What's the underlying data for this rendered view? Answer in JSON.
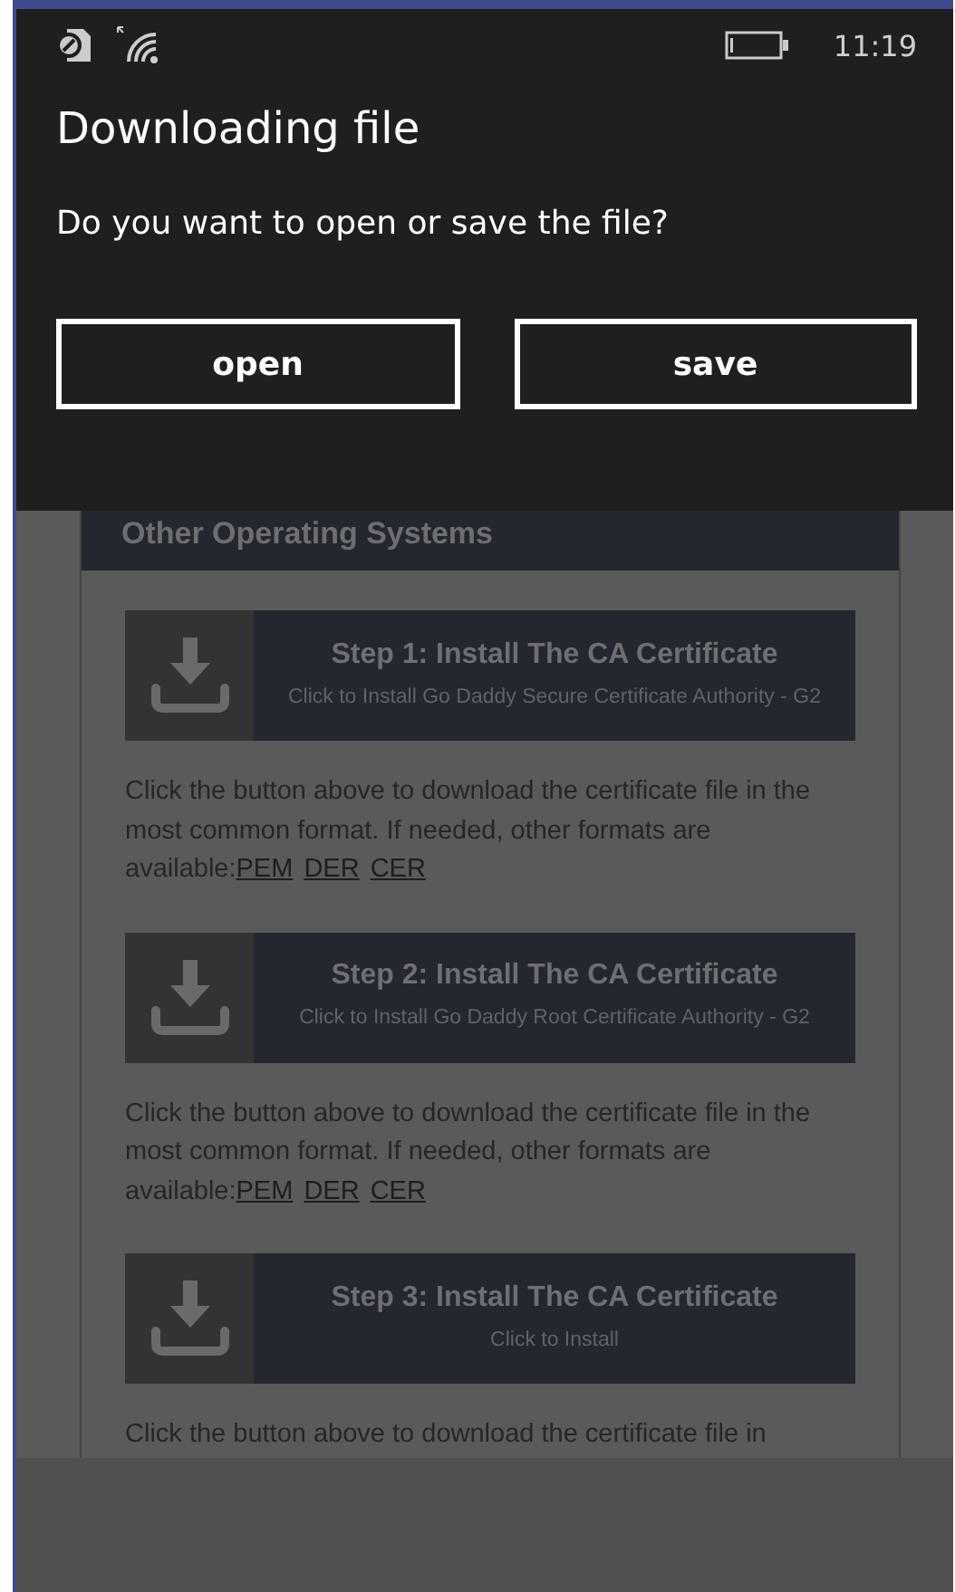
{
  "status_bar": {
    "time": "11:19"
  },
  "dialog": {
    "title": "Downloading file",
    "message": "Do you want to open or save the file?",
    "buttons": [
      "open",
      "save"
    ]
  },
  "page": {
    "section_title": "Other Operating Systems",
    "steps": [
      {
        "title": "Step 1: Install The CA Certificate",
        "subtitle": "Click to Install Go Daddy Secure Certificate Authority - G2",
        "note": "Click the button above to download the certificate file in the most common format. If needed, other formats are available:",
        "links": [
          "PEM",
          "DER",
          "CER"
        ]
      },
      {
        "title": "Step 2: Install The CA Certificate",
        "subtitle": "Click to Install Go Daddy Root Certificate Authority - G2",
        "note": "Click the button above to download the certificate file in the most common format. If needed, other formats are available:",
        "links": [
          "PEM",
          "DER",
          "CER"
        ]
      },
      {
        "title": "Step 3: Install The CA Certificate",
        "subtitle": "Click to Install",
        "note": "Click the button above to download the certificate file in"
      }
    ]
  }
}
